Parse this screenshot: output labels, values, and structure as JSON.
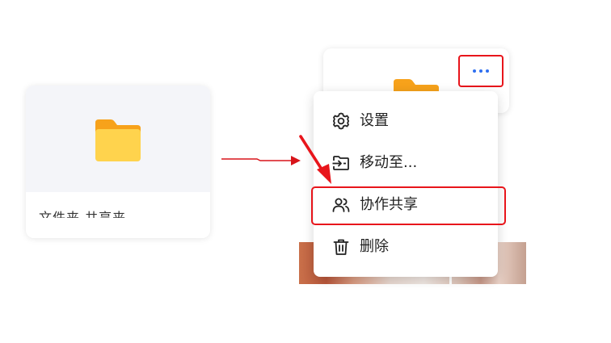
{
  "left_card": {
    "partial_name": "文件夹 共享夹"
  },
  "menu": {
    "items": [
      {
        "label": "设置",
        "icon": "gear-icon"
      },
      {
        "label": "移动至...",
        "icon": "move-to-folder-icon"
      },
      {
        "label": "协作共享",
        "icon": "users-icon"
      },
      {
        "label": "删除",
        "icon": "trash-icon"
      }
    ]
  },
  "more_button": {
    "icon": "more-horizontal-icon"
  },
  "colors": {
    "highlight": "#e8151b",
    "accent_blue": "#2f6ff0",
    "folder_front": "#ffd34d",
    "folder_back": "#f7a21b"
  }
}
